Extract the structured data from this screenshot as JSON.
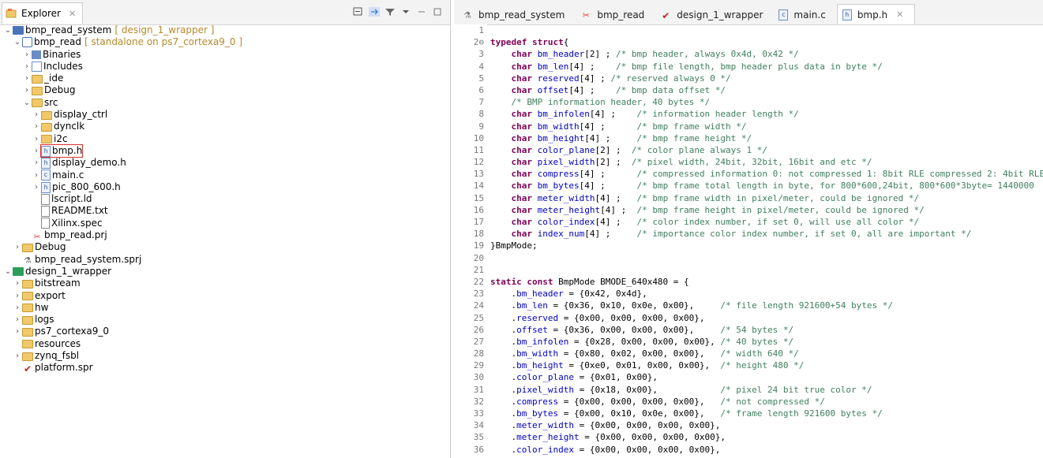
{
  "explorer": {
    "tab_label": "Explorer",
    "tab_close": "✕",
    "tree": [
      {
        "label": "bmp_read_system",
        "deco": "[ design_1_wrapper ]",
        "depth": 0,
        "twisty": "v",
        "icon": "proj"
      },
      {
        "label": "bmp_read",
        "deco": "[ standalone on ps7_cortexa9_0 ]",
        "depth": 1,
        "twisty": "v",
        "icon": "app"
      },
      {
        "label": "Binaries",
        "deco": "",
        "depth": 2,
        "twisty": ">",
        "icon": "bin"
      },
      {
        "label": "Includes",
        "deco": "",
        "depth": 2,
        "twisty": ">",
        "icon": "inc"
      },
      {
        "label": "_ide",
        "deco": "",
        "depth": 2,
        "twisty": ">",
        "icon": "folder"
      },
      {
        "label": "Debug",
        "deco": "",
        "depth": 2,
        "twisty": ">",
        "icon": "folder"
      },
      {
        "label": "src",
        "deco": "",
        "depth": 2,
        "twisty": "v",
        "icon": "folder"
      },
      {
        "label": "display_ctrl",
        "deco": "",
        "depth": 3,
        "twisty": ">",
        "icon": "folder"
      },
      {
        "label": "dynclk",
        "deco": "",
        "depth": 3,
        "twisty": ">",
        "icon": "folder"
      },
      {
        "label": "i2c",
        "deco": "",
        "depth": 3,
        "twisty": ">",
        "icon": "folder"
      },
      {
        "label": "bmp.h",
        "deco": "",
        "depth": 3,
        "twisty": ">",
        "icon": "h",
        "highlight": true
      },
      {
        "label": "display_demo.h",
        "deco": "",
        "depth": 3,
        "twisty": ">",
        "icon": "h"
      },
      {
        "label": "main.c",
        "deco": "",
        "depth": 3,
        "twisty": ">",
        "icon": "c"
      },
      {
        "label": "pic_800_600.h",
        "deco": "",
        "depth": 3,
        "twisty": ">",
        "icon": "h"
      },
      {
        "label": "lscript.ld",
        "deco": "",
        "depth": 3,
        "twisty": "",
        "icon": "t"
      },
      {
        "label": "README.txt",
        "deco": "",
        "depth": 3,
        "twisty": "",
        "icon": "t"
      },
      {
        "label": "Xilinx.spec",
        "deco": "",
        "depth": 3,
        "twisty": "",
        "icon": "t"
      },
      {
        "label": "bmp_read.prj",
        "deco": "",
        "depth": 2,
        "twisty": "",
        "icon": "prj"
      },
      {
        "label": "Debug",
        "deco": "",
        "depth": 1,
        "twisty": ">",
        "icon": "folder"
      },
      {
        "label": "bmp_read_system.sprj",
        "deco": "",
        "depth": 1,
        "twisty": "",
        "icon": "sprj"
      },
      {
        "label": "design_1_wrapper",
        "deco": "",
        "depth": 0,
        "twisty": "v",
        "icon": "hw"
      },
      {
        "label": "bitstream",
        "deco": "",
        "depth": 1,
        "twisty": ">",
        "icon": "folder"
      },
      {
        "label": "export",
        "deco": "",
        "depth": 1,
        "twisty": ">",
        "icon": "folder"
      },
      {
        "label": "hw",
        "deco": "",
        "depth": 1,
        "twisty": ">",
        "icon": "folder"
      },
      {
        "label": "logs",
        "deco": "",
        "depth": 1,
        "twisty": ">",
        "icon": "folder"
      },
      {
        "label": "ps7_cortexa9_0",
        "deco": "",
        "depth": 1,
        "twisty": ">",
        "icon": "folder"
      },
      {
        "label": "resources",
        "deco": "",
        "depth": 1,
        "twisty": "",
        "icon": "folder"
      },
      {
        "label": "zynq_fsbl",
        "deco": "",
        "depth": 1,
        "twisty": ">",
        "icon": "folder"
      },
      {
        "label": "platform.spr",
        "deco": "",
        "depth": 1,
        "twisty": "",
        "icon": "spr"
      }
    ]
  },
  "editor": {
    "tabs": [
      {
        "label": "bmp_read_system",
        "icon": "sprj",
        "active": false
      },
      {
        "label": "bmp_read",
        "icon": "prj",
        "active": false
      },
      {
        "label": "design_1_wrapper",
        "icon": "spr",
        "active": false
      },
      {
        "label": "main.c",
        "icon": "c",
        "active": false
      },
      {
        "label": "bmp.h",
        "icon": "h",
        "active": true
      }
    ],
    "tab_close": "✕",
    "lines": [
      {
        "n": "1",
        "t": []
      },
      {
        "n": "2⊖",
        "t": [
          [
            "kw",
            "typedef struct"
          ],
          [
            "ty",
            "{"
          ]
        ]
      },
      {
        "n": "3",
        "t": [
          [
            "ty",
            "    "
          ],
          [
            "kw",
            "char"
          ],
          [
            "ty",
            " "
          ],
          [
            "fd",
            "bm_header"
          ],
          [
            "ty",
            "[2] ; "
          ],
          [
            "cm",
            "/* bmp header, always 0x4d, 0x42 */"
          ]
        ]
      },
      {
        "n": "4",
        "t": [
          [
            "ty",
            "    "
          ],
          [
            "kw",
            "char"
          ],
          [
            "ty",
            " "
          ],
          [
            "fd",
            "bm_len"
          ],
          [
            "ty",
            "[4] ;    "
          ],
          [
            "cm",
            "/* bmp file length, bmp header plus data in byte */"
          ]
        ]
      },
      {
        "n": "5",
        "t": [
          [
            "ty",
            "    "
          ],
          [
            "kw",
            "char"
          ],
          [
            "ty",
            " "
          ],
          [
            "fd",
            "reserved"
          ],
          [
            "ty",
            "[4] ; "
          ],
          [
            "cm",
            "/* reserved always 0 */"
          ]
        ]
      },
      {
        "n": "6",
        "t": [
          [
            "ty",
            "    "
          ],
          [
            "kw",
            "char"
          ],
          [
            "ty",
            " "
          ],
          [
            "fd",
            "offset"
          ],
          [
            "ty",
            "[4] ;    "
          ],
          [
            "cm",
            "/* bmp data offset */"
          ]
        ]
      },
      {
        "n": "7",
        "t": [
          [
            "ty",
            "    "
          ],
          [
            "cm",
            "/* BMP information header, 40 bytes */"
          ]
        ]
      },
      {
        "n": "8",
        "t": [
          [
            "ty",
            "    "
          ],
          [
            "kw",
            "char"
          ],
          [
            "ty",
            " "
          ],
          [
            "fd",
            "bm_infolen"
          ],
          [
            "ty",
            "[4] ;    "
          ],
          [
            "cm",
            "/* information header length */"
          ]
        ]
      },
      {
        "n": "9",
        "t": [
          [
            "ty",
            "    "
          ],
          [
            "kw",
            "char"
          ],
          [
            "ty",
            " "
          ],
          [
            "fd",
            "bm_width"
          ],
          [
            "ty",
            "[4] ;      "
          ],
          [
            "cm",
            "/* bmp frame width */"
          ]
        ]
      },
      {
        "n": "10",
        "t": [
          [
            "ty",
            "    "
          ],
          [
            "kw",
            "char"
          ],
          [
            "ty",
            " "
          ],
          [
            "fd",
            "bm_height"
          ],
          [
            "ty",
            "[4] ;     "
          ],
          [
            "cm",
            "/* bmp frame height */"
          ]
        ]
      },
      {
        "n": "11",
        "t": [
          [
            "ty",
            "    "
          ],
          [
            "kw",
            "char"
          ],
          [
            "ty",
            " "
          ],
          [
            "fd",
            "color_plane"
          ],
          [
            "ty",
            "[2] ;  "
          ],
          [
            "cm",
            "/* color plane always 1 */"
          ]
        ]
      },
      {
        "n": "12",
        "t": [
          [
            "ty",
            "    "
          ],
          [
            "kw",
            "char"
          ],
          [
            "ty",
            " "
          ],
          [
            "fd",
            "pixel_width"
          ],
          [
            "ty",
            "[2] ;  "
          ],
          [
            "cm",
            "/* pixel width, 24bit, 32bit, 16bit and etc */"
          ]
        ]
      },
      {
        "n": "13",
        "t": [
          [
            "ty",
            "    "
          ],
          [
            "kw",
            "char"
          ],
          [
            "ty",
            " "
          ],
          [
            "fd",
            "compress"
          ],
          [
            "ty",
            "[4] ;      "
          ],
          [
            "cm",
            "/* compressed information 0: not compressed 1: 8bit RLE compressed 2: 4bit RLE"
          ]
        ]
      },
      {
        "n": "14",
        "t": [
          [
            "ty",
            "    "
          ],
          [
            "kw",
            "char"
          ],
          [
            "ty",
            " "
          ],
          [
            "fd",
            "bm_bytes"
          ],
          [
            "ty",
            "[4] ;      "
          ],
          [
            "cm",
            "/* bmp frame total length in byte, for 800*600,24bit, 800*600*3byte= 1440000"
          ]
        ]
      },
      {
        "n": "15",
        "t": [
          [
            "ty",
            "    "
          ],
          [
            "kw",
            "char"
          ],
          [
            "ty",
            " "
          ],
          [
            "fd",
            "meter_width"
          ],
          [
            "ty",
            "[4] ;   "
          ],
          [
            "cm",
            "/* bmp frame width in pixel/meter, could be ignored */"
          ]
        ]
      },
      {
        "n": "16",
        "t": [
          [
            "ty",
            "    "
          ],
          [
            "kw",
            "char"
          ],
          [
            "ty",
            " "
          ],
          [
            "fd",
            "meter_height"
          ],
          [
            "ty",
            "[4] ;  "
          ],
          [
            "cm",
            "/* bmp frame height in pixel/meter, could be ignored */"
          ]
        ]
      },
      {
        "n": "17",
        "t": [
          [
            "ty",
            "    "
          ],
          [
            "kw",
            "char"
          ],
          [
            "ty",
            " "
          ],
          [
            "fd",
            "color_index"
          ],
          [
            "ty",
            "[4] ;   "
          ],
          [
            "cm",
            "/* color index number, if set 0, will use all color */"
          ]
        ]
      },
      {
        "n": "18",
        "t": [
          [
            "ty",
            "    "
          ],
          [
            "kw",
            "char"
          ],
          [
            "ty",
            " "
          ],
          [
            "fd",
            "index_num"
          ],
          [
            "ty",
            "[4] ;     "
          ],
          [
            "cm",
            "/* importance color index number, if set 0, all are important */"
          ]
        ]
      },
      {
        "n": "19",
        "t": [
          [
            "ty",
            "}BmpMode;"
          ]
        ]
      },
      {
        "n": "20",
        "t": []
      },
      {
        "n": "21",
        "t": []
      },
      {
        "n": "22",
        "t": [
          [
            "kw",
            "static const"
          ],
          [
            "ty",
            " BmpMode BMODE_640x480 = {"
          ]
        ]
      },
      {
        "n": "23",
        "t": [
          [
            "ty",
            "    ."
          ],
          [
            "fd",
            "bm_header"
          ],
          [
            "ty",
            " = {0x42, 0x4d},"
          ]
        ]
      },
      {
        "n": "24",
        "t": [
          [
            "ty",
            "    ."
          ],
          [
            "fd",
            "bm_len"
          ],
          [
            "ty",
            " = {0x36, 0x10, 0x0e, 0x00},     "
          ],
          [
            "cm",
            "/* file length 921600+54 bytes */"
          ]
        ]
      },
      {
        "n": "25",
        "t": [
          [
            "ty",
            "    ."
          ],
          [
            "fd",
            "reserved"
          ],
          [
            "ty",
            " = {0x00, 0x00, 0x00, 0x00},"
          ]
        ]
      },
      {
        "n": "26",
        "t": [
          [
            "ty",
            "    ."
          ],
          [
            "fd",
            "offset"
          ],
          [
            "ty",
            " = {0x36, 0x00, 0x00, 0x00},     "
          ],
          [
            "cm",
            "/* 54 bytes */"
          ]
        ]
      },
      {
        "n": "27",
        "t": [
          [
            "ty",
            "    ."
          ],
          [
            "fd",
            "bm_infolen"
          ],
          [
            "ty",
            " = {0x28, 0x00, 0x00, 0x00}, "
          ],
          [
            "cm",
            "/* 40 bytes */"
          ]
        ]
      },
      {
        "n": "28",
        "t": [
          [
            "ty",
            "    ."
          ],
          [
            "fd",
            "bm_width"
          ],
          [
            "ty",
            " = {0x80, 0x02, 0x00, 0x00},   "
          ],
          [
            "cm",
            "/* width 640 */"
          ]
        ]
      },
      {
        "n": "29",
        "t": [
          [
            "ty",
            "    ."
          ],
          [
            "fd",
            "bm_height"
          ],
          [
            "ty",
            " = {0xe0, 0x01, 0x00, 0x00},  "
          ],
          [
            "cm",
            "/* height 480 */"
          ]
        ]
      },
      {
        "n": "30",
        "t": [
          [
            "ty",
            "    ."
          ],
          [
            "fd",
            "color_plane"
          ],
          [
            "ty",
            " = {0x01, 0x00},"
          ]
        ]
      },
      {
        "n": "31",
        "t": [
          [
            "ty",
            "    ."
          ],
          [
            "fd",
            "pixel_width"
          ],
          [
            "ty",
            " = {0x18, 0x00},            "
          ],
          [
            "cm",
            "/* pixel 24 bit true color */"
          ]
        ]
      },
      {
        "n": "32",
        "t": [
          [
            "ty",
            "    ."
          ],
          [
            "fd",
            "compress"
          ],
          [
            "ty",
            " = {0x00, 0x00, 0x00, 0x00},   "
          ],
          [
            "cm",
            "/* not compressed */"
          ]
        ]
      },
      {
        "n": "33",
        "t": [
          [
            "ty",
            "    ."
          ],
          [
            "fd",
            "bm_bytes"
          ],
          [
            "ty",
            " = {0x00, 0x10, 0x0e, 0x00},   "
          ],
          [
            "cm",
            "/* frame length 921600 bytes */"
          ]
        ]
      },
      {
        "n": "34",
        "t": [
          [
            "ty",
            "    ."
          ],
          [
            "fd",
            "meter_width"
          ],
          [
            "ty",
            " = {0x00, 0x00, 0x00, 0x00},"
          ]
        ]
      },
      {
        "n": "35",
        "t": [
          [
            "ty",
            "    ."
          ],
          [
            "fd",
            "meter_height"
          ],
          [
            "ty",
            " = {0x00, 0x00, 0x00, 0x00},"
          ]
        ]
      },
      {
        "n": "36",
        "t": [
          [
            "ty",
            "    ."
          ],
          [
            "fd",
            "color_index"
          ],
          [
            "ty",
            " = {0x00, 0x00, 0x00, 0x00},"
          ]
        ]
      }
    ]
  }
}
